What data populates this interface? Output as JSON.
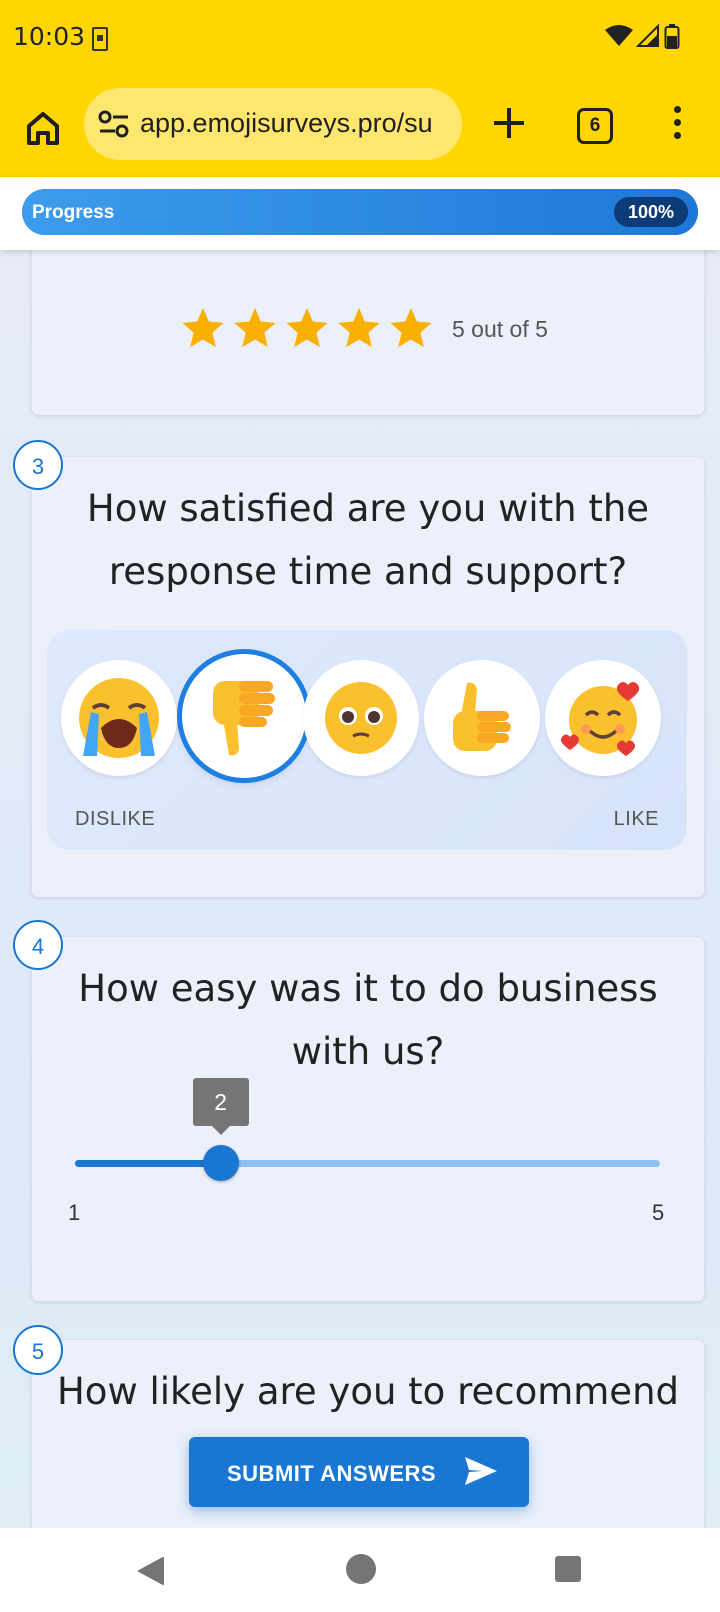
{
  "status": {
    "time": "10:03"
  },
  "browser": {
    "url": "app.emojisurveys.pro/su",
    "tab_count": "6"
  },
  "progress": {
    "label": "Progress",
    "percent_text": "100%",
    "value": 1.0
  },
  "q2": {
    "rating": 5,
    "max": 5,
    "rating_text": "5 out of 5"
  },
  "q3": {
    "number": "3",
    "title_line1": "How satisfied are you with the",
    "title_line2": "response time and support?",
    "options": [
      "loudly-crying-face",
      "thumbs-down",
      "pleading-face",
      "thumbs-up",
      "smiling-face-with-hearts"
    ],
    "selected_index": 1,
    "scale_left": "DISLIKE",
    "scale_right": "LIKE"
  },
  "q4": {
    "number": "4",
    "title_line1": "How easy was it to do business",
    "title_line2": "with us?",
    "min": 1,
    "max": 5,
    "value": 2,
    "min_label": "1",
    "max_label": "5",
    "value_label": "2"
  },
  "q5": {
    "number": "5",
    "title_line1": "How likely are you to recommend"
  },
  "submit": {
    "label": "SUBMIT ANSWERS"
  },
  "colors": {
    "chrome": "#ffd600",
    "accent": "#1976d2",
    "star": "#f9b000"
  }
}
